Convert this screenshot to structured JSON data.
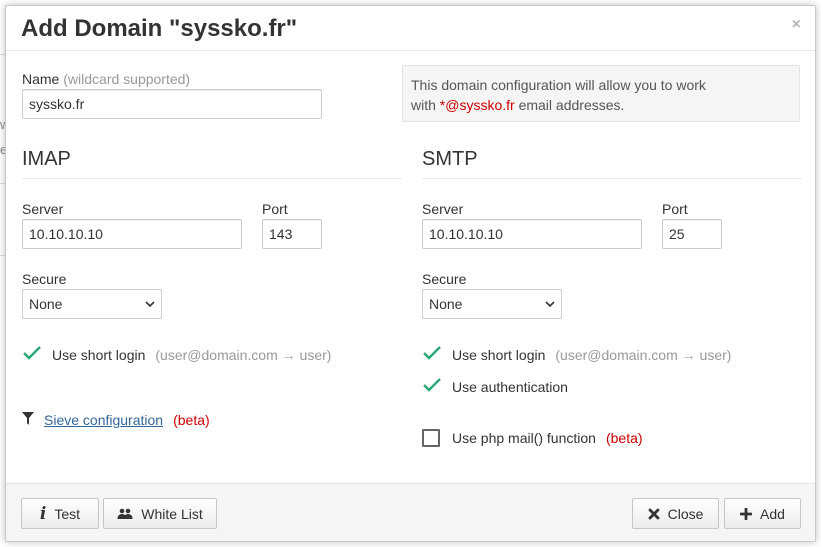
{
  "dialog": {
    "title": "Add Domain \"syssko.fr\"",
    "close_glyph": "×"
  },
  "name_field": {
    "label": "Name",
    "hint": "(wildcard supported)",
    "value": "syssko.fr"
  },
  "info": {
    "line1": "This domain configuration will allow you to work",
    "line2_prefix": "with ",
    "line2_highlight": "*@syssko.fr",
    "line2_suffix": " email addresses."
  },
  "imap": {
    "title": "IMAP",
    "server_label": "Server",
    "server_value": "10.10.10.10",
    "port_label": "Port",
    "port_value": "143",
    "secure_label": "Secure",
    "secure_value": "None",
    "short_login_label": "Use short login",
    "short_login_hint": "(user@domain.com → user)",
    "short_login_checked": true,
    "sieve_link": "Sieve configuration",
    "sieve_beta": "(beta)"
  },
  "smtp": {
    "title": "SMTP",
    "server_label": "Server",
    "server_value": "10.10.10.10",
    "port_label": "Port",
    "port_value": "25",
    "secure_label": "Secure",
    "secure_value": "None",
    "short_login_label": "Use short login",
    "short_login_hint": "(user@domain.com → user)",
    "short_login_checked": true,
    "auth_label": "Use authentication",
    "auth_checked": true,
    "php_mail_label": "Use php mail() function",
    "php_mail_beta": "(beta)",
    "php_mail_checked": false
  },
  "footer": {
    "test_label": "Test",
    "whitelist_label": "White List",
    "close_label": "Close",
    "add_label": "Add"
  },
  "background": {
    "char1": "w",
    "char2": "e"
  },
  "colors": {
    "check_green": "#2aa876",
    "beta_red": "#d00000",
    "link_blue": "#336699"
  }
}
